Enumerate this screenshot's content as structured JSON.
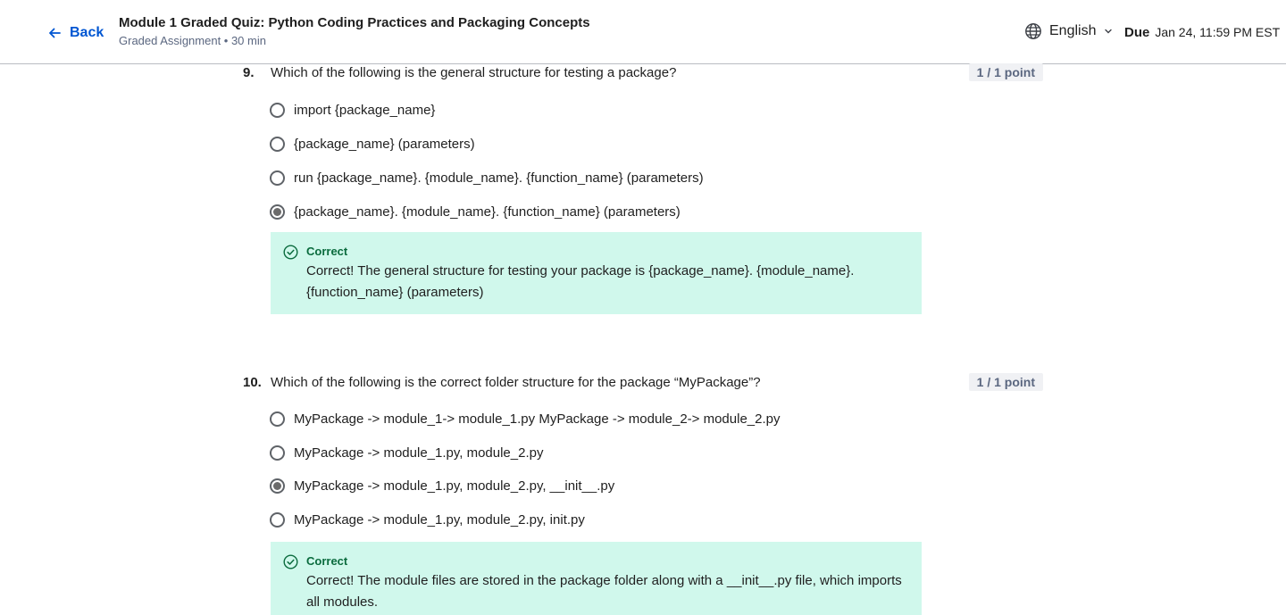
{
  "header": {
    "back_label": "Back",
    "title": "Module 1 Graded Quiz: Python Coding Practices and Packaging Concepts",
    "subtitle": "Graded Assignment • 30 min",
    "language": "English",
    "due_label": "Due",
    "due_value": "Jan 24, 11:59 PM EST"
  },
  "questions": [
    {
      "number": "9.",
      "text": "Which of the following is the general structure for testing a package?",
      "points": "1 / 1 point",
      "options": [
        {
          "label": "import {package_name}",
          "selected": false
        },
        {
          "label": "{package_name} (parameters)",
          "selected": false
        },
        {
          "label": "run {package_name}. {module_name}. {function_name} (parameters)",
          "selected": false
        },
        {
          "label": "{package_name}. {module_name}. {function_name} (parameters)",
          "selected": true
        }
      ],
      "feedback": {
        "status": "Correct",
        "text": "Correct! The general structure for testing your package is {package_name}. {module_name}. {function_name} (parameters)"
      }
    },
    {
      "number": "10.",
      "text": "Which of the following is the correct folder structure for the package “MyPackage”?",
      "points": "1 / 1 point",
      "options": [
        {
          "label": "MyPackage -> module_1-> module_1.py MyPackage -> module_2-> module_2.py",
          "selected": false
        },
        {
          "label": "MyPackage -> module_1.py, module_2.py",
          "selected": false
        },
        {
          "label": "MyPackage -> module_1.py, module_2.py, __init__.py",
          "selected": true
        },
        {
          "label": "MyPackage -> module_1.py, module_2.py, init.py",
          "selected": false
        }
      ],
      "feedback": {
        "status": "Correct",
        "text": "Correct! The module files are stored in the package folder along with a __init__.py file, which imports all modules."
      }
    }
  ],
  "colors": {
    "accent": "#0056d2",
    "feedback_bg": "#d0f8ec",
    "correct_green": "#0a6b3d",
    "points_bg": "#f0f1f4"
  },
  "icons": {
    "back": "arrow-left-icon",
    "language": "globe-icon",
    "dropdown": "chevron-down-icon",
    "correct": "check-circle-icon"
  }
}
